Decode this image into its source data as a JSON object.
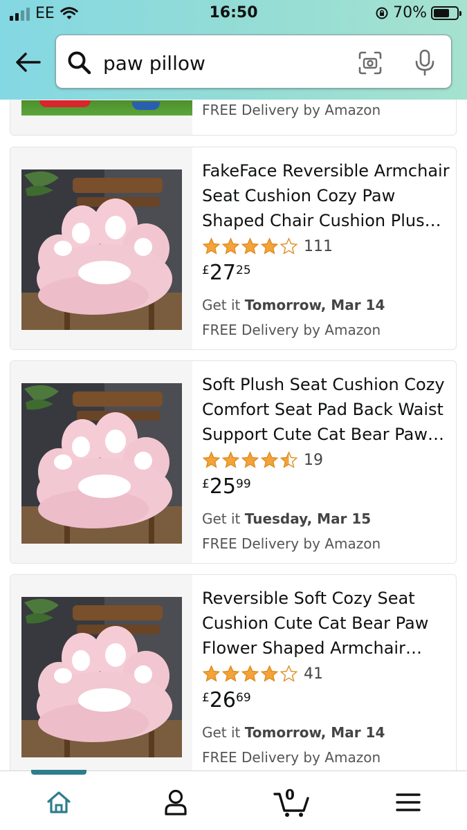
{
  "status_bar": {
    "carrier": "EE",
    "time": "16:50",
    "battery": "70%",
    "battery_level": 0.7
  },
  "search": {
    "query": "paw pillow"
  },
  "partial_result": {
    "free_delivery": "FREE Delivery by Amazon"
  },
  "results": [
    {
      "title": "FakeFace Reversible Armchair Seat Cushion Cozy Paw Shaped Chair Cushion Plush Comfort…",
      "rating": 4.0,
      "rating_count": "111",
      "price_currency": "£",
      "price_whole": "27",
      "price_fraction": "25",
      "delivery_prefix": "Get it ",
      "delivery_date": "Tomorrow, Mar 14",
      "free_delivery": "FREE Delivery by Amazon"
    },
    {
      "title": "Soft Plush Seat Cushion Cozy Comfort Seat Pad Back Waist Support Cute Cat Bear Paw…",
      "rating": 4.5,
      "rating_count": "19",
      "price_currency": "£",
      "price_whole": "25",
      "price_fraction": "99",
      "delivery_prefix": "Get it ",
      "delivery_date": "Tuesday, Mar 15",
      "free_delivery": "FREE Delivery by Amazon"
    },
    {
      "title": "Reversible Soft Cozy Seat Cushion Cute Cat Bear Paw Flower Shaped Armchair Cha…",
      "rating": 4.0,
      "rating_count": "41",
      "price_currency": "£",
      "price_whole": "26",
      "price_fraction": "69",
      "delivery_prefix": "Get it ",
      "delivery_date": "Tomorrow, Mar 14",
      "free_delivery": "FREE Delivery by Amazon"
    }
  ],
  "bottom_nav": {
    "cart_count": "0",
    "items": [
      "home-icon",
      "account-icon",
      "cart-icon",
      "menu-icon"
    ]
  },
  "colors": {
    "star": "#f3a33a",
    "header_start": "#84d8e3",
    "header_end": "#a5e2cf",
    "nav_active": "#2e7d8c"
  }
}
